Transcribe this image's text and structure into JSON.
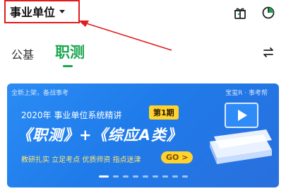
{
  "header": {
    "category_label": "事业单位"
  },
  "tabs": [
    {
      "label": "公基",
      "active": false
    },
    {
      "label": "职测",
      "active": true
    }
  ],
  "banner": {
    "top_left_text": "全新上架，备战事考",
    "top_right_text": "宝玺R · 事考帮",
    "subtitle": "2020年 事业单位系统精讲",
    "episode_badge": "第1期",
    "main_title": "《职测》+《综应A类》",
    "tagline": "教研扎实 立足考点  优质师资 指点迷津",
    "go_label": "GO >",
    "dots_count": 9,
    "active_dot": 0
  },
  "colors": {
    "accent_green": "#1aa64f",
    "highlight_red": "#e21b1b",
    "banner_blue": "#1f7be9",
    "badge_yellow": "#ffd22e"
  },
  "icons": {
    "header_right": [
      "gift-icon",
      "pie-chart-icon"
    ],
    "tabs_right": "swap-arrows-icon"
  }
}
